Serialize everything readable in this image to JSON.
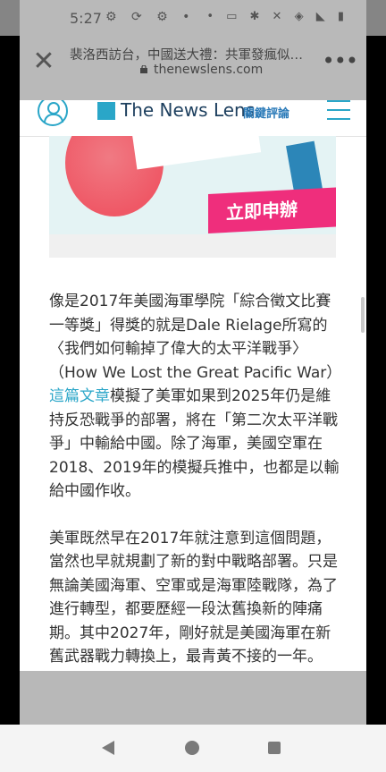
{
  "status_bar": {
    "time": "5:27",
    "left_icons": [
      "android-icon",
      "sync-icon",
      "android-icon",
      "dot-icon"
    ],
    "right_icons": [
      "dot-icon",
      "battery-saver-icon",
      "bluetooth-icon",
      "nfc-icon",
      "mute-icon",
      "wifi-icon",
      "signal-icon",
      "battery-icon"
    ]
  },
  "browser": {
    "page_title": "裴洛西訪台，中國送大禮：共軍發瘋似的...",
    "domain": "thenewslens.com"
  },
  "site_header": {
    "logo_text": "The News Lens",
    "logo_sub": "關鍵評論"
  },
  "banner": {
    "cta_text": "立即申辦",
    "accent_color": "#ef2e7c"
  },
  "article": {
    "paragraph1_before_link": "像是2017年美國海軍學院「綜合徵文比賽一等獎」得獎的就是Dale Rielage所寫的〈我們如何輸掉了偉大的太平洋戰爭〉（How We Lost the Great Pacific War）",
    "paragraph1_link": "這篇文章",
    "paragraph1_after_link": "模擬了美軍如果到2025年仍是維持反恐戰爭的部署，將在「第二次太平洋戰爭」中輸給中國。除了海軍，美國空軍在2018、2019年的模擬兵推中，也都是以輸給中國作收。",
    "paragraph2": "美軍既然早在2017年就注意到這個問題，當然也早就規劃了新的對中戰略部署。只是無論美國海軍、空軍或是海軍陸戰隊，為了進行轉型，都要歷經一段汰舊換新的陣痛期。其中2027年，剛好就是美國海軍在新舊武器戰力轉換上，最青黃不接的一年。"
  },
  "colors": {
    "brand": "#2aa6c8",
    "link": "#2aa6c8"
  }
}
